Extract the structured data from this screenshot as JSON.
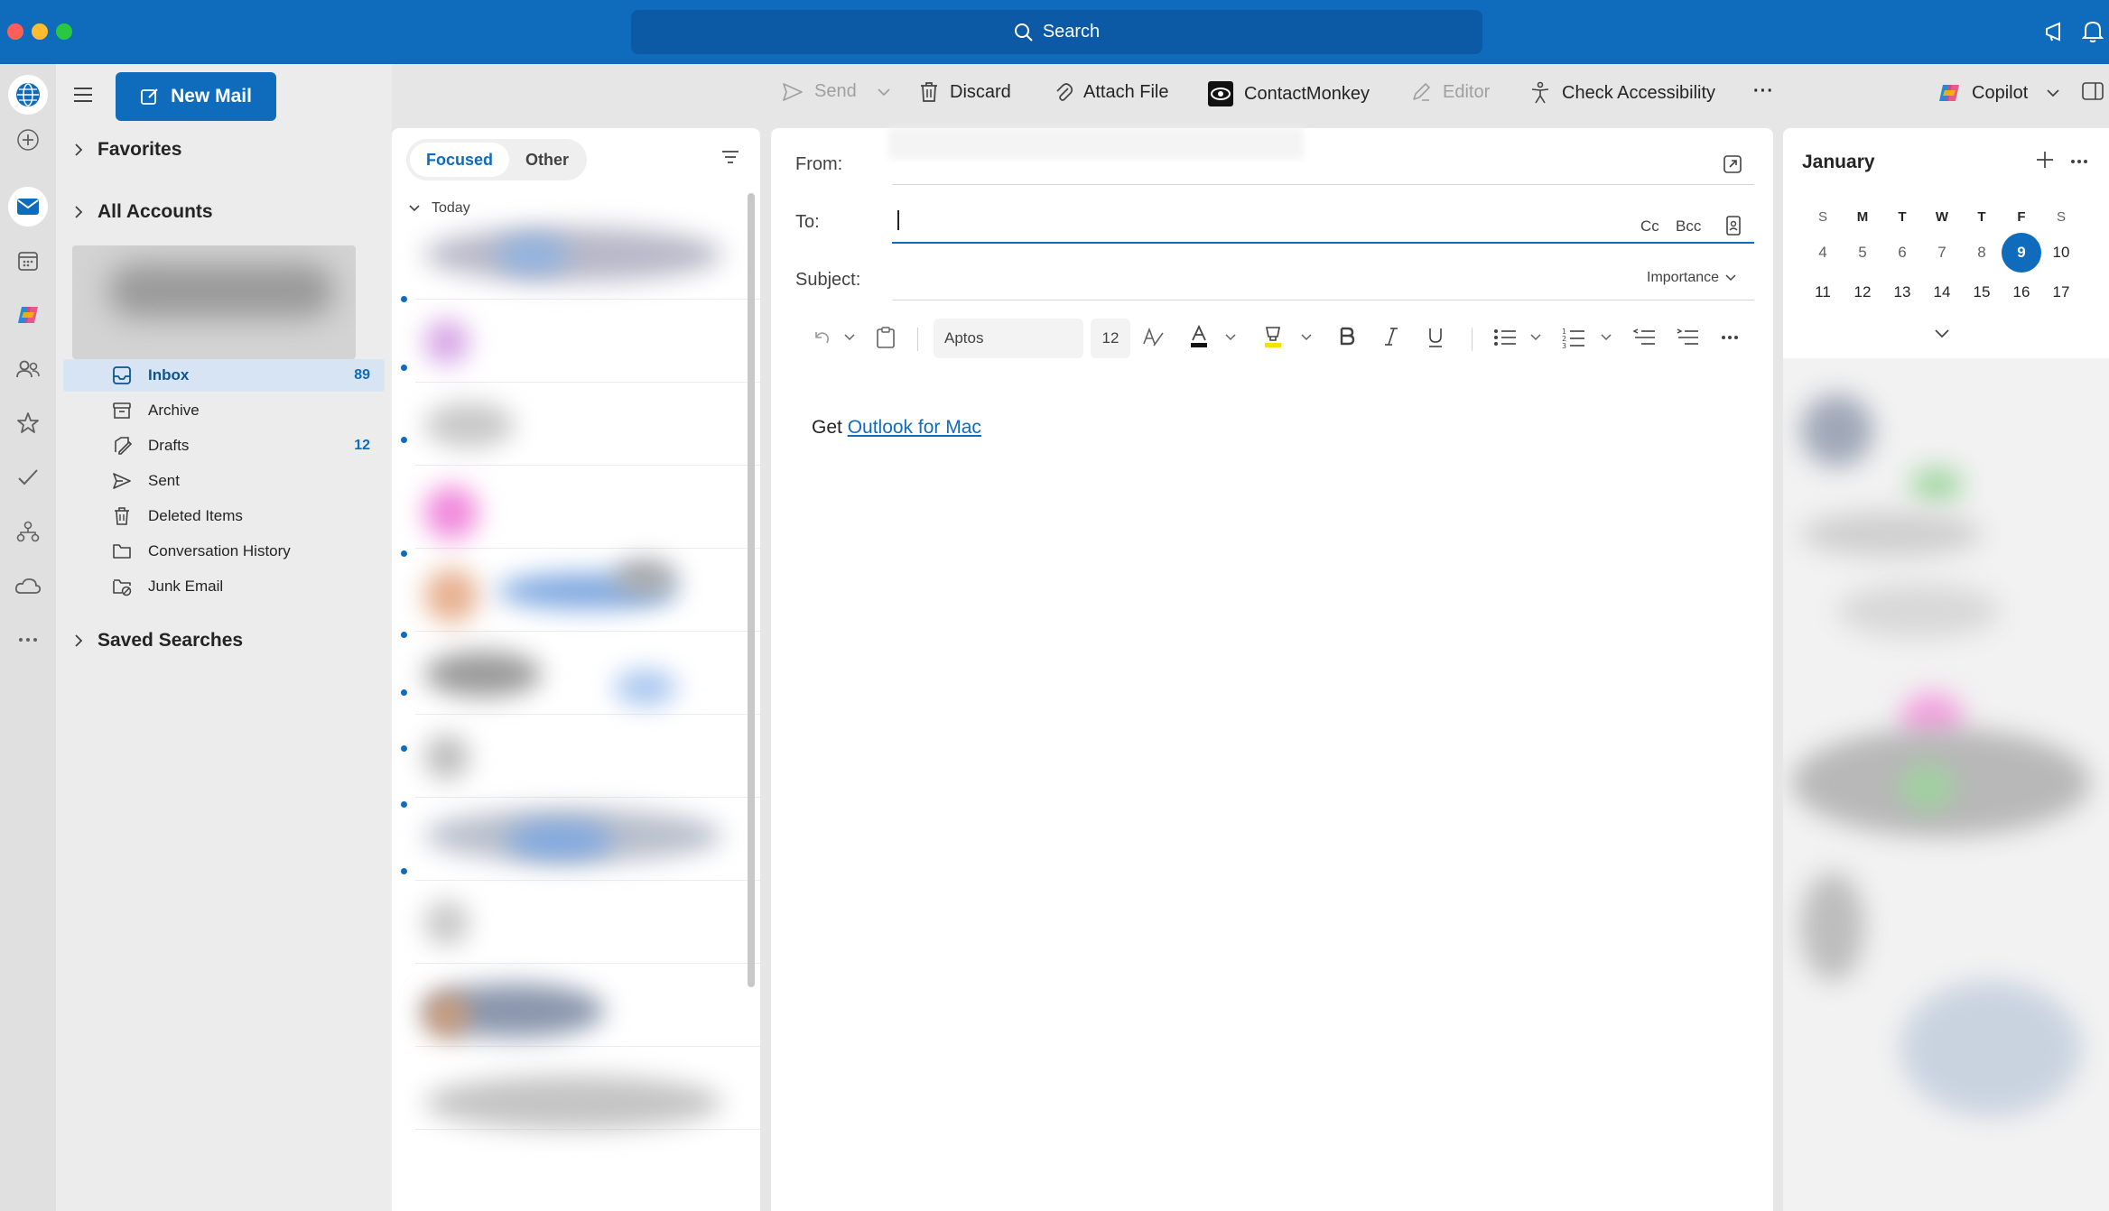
{
  "search": {
    "label": "Search"
  },
  "folder_pane": {
    "new_mail_label": "New Mail",
    "favorites_label": "Favorites",
    "all_accounts_label": "All Accounts",
    "saved_searches_label": "Saved Searches",
    "folders": [
      {
        "label": "Inbox",
        "count": "89",
        "icon": "inbox-icon",
        "selected": true
      },
      {
        "label": "Archive",
        "count": "",
        "icon": "archive-icon"
      },
      {
        "label": "Drafts",
        "count": "12",
        "icon": "drafts-icon"
      },
      {
        "label": "Sent",
        "count": "",
        "icon": "sent-icon"
      },
      {
        "label": "Deleted Items",
        "count": "",
        "icon": "trash-icon"
      },
      {
        "label": "Conversation History",
        "count": "",
        "icon": "folder-icon"
      },
      {
        "label": "Junk Email",
        "count": "",
        "icon": "junk-icon"
      }
    ]
  },
  "message_list": {
    "tab_focused": "Focused",
    "tab_other": "Other",
    "group_today": "Today"
  },
  "toolbar": {
    "send": "Send",
    "discard": "Discard",
    "attach_file": "Attach File",
    "contactmonkey": "ContactMonkey",
    "editor": "Editor",
    "check_accessibility": "Check Accessibility",
    "more": "···",
    "copilot": "Copilot"
  },
  "compose": {
    "from_label": "From:",
    "to_label": "To:",
    "cc_label": "Cc",
    "bcc_label": "Bcc",
    "subject_label": "Subject:",
    "importance_label": "Importance",
    "font_name": "Aptos",
    "font_size": "12",
    "body_prefix": "Get ",
    "body_link": "Outlook for Mac"
  },
  "calendar": {
    "month": "January",
    "weekdays": [
      "S",
      "M",
      "T",
      "W",
      "T",
      "F",
      "S"
    ],
    "week1": [
      "4",
      "5",
      "6",
      "7",
      "8",
      "9",
      "10"
    ],
    "week2": [
      "11",
      "12",
      "13",
      "14",
      "15",
      "16",
      "17"
    ],
    "today": "9"
  },
  "colors": {
    "accent": "#0f6cbd",
    "titlebar": "#0f6cbd",
    "selected_folder_bg": "#d6e4f3"
  }
}
